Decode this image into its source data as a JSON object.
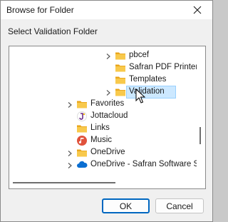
{
  "window": {
    "title": "Browse for Folder"
  },
  "titlebar": {
    "close_icon": "close-icon"
  },
  "prompt": "Select Validation Folder",
  "tree": {
    "items": [
      {
        "label": "pbcef",
        "icon": "folder-icon",
        "expander": true,
        "selected": false
      },
      {
        "label": "Safran PDF Printer",
        "icon": "folder-icon",
        "expander": false,
        "selected": false
      },
      {
        "label": "Templates",
        "icon": "folder-icon",
        "expander": false,
        "selected": false
      },
      {
        "label": "Validation",
        "icon": "folder-icon",
        "expander": true,
        "selected": true
      },
      {
        "label": "Favorites",
        "icon": "folder-icon",
        "expander": true,
        "selected": false
      },
      {
        "label": "Jottacloud",
        "icon": "jottacloud-icon",
        "expander": false,
        "selected": false
      },
      {
        "label": "Links",
        "icon": "folder-icon",
        "expander": false,
        "selected": false
      },
      {
        "label": "Music",
        "icon": "music-icon",
        "expander": false,
        "selected": false
      },
      {
        "label": "OneDrive",
        "icon": "folder-icon",
        "expander": true,
        "selected": false
      },
      {
        "label": "OneDrive - Safran Software Solu",
        "icon": "onedrive-icon",
        "expander": true,
        "selected": false
      }
    ]
  },
  "buttons": {
    "ok": "OK",
    "cancel": "Cancel"
  },
  "colors": {
    "selection": "#cce8ff",
    "accent": "#0067c0",
    "folder": "#f8c94c"
  }
}
